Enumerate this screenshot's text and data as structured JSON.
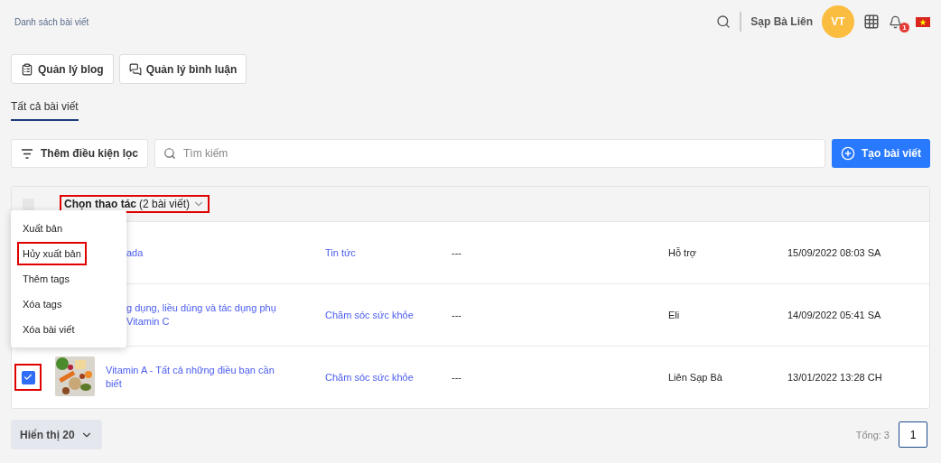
{
  "breadcrumb": "Danh sách bài viết",
  "header": {
    "user_name": "Sạp Bà Liên",
    "avatar_initials": "VT",
    "notification_count": "1"
  },
  "nav_buttons": [
    {
      "label": "Quản lý blog",
      "kind": "blog"
    },
    {
      "label": "Quản lý bình luận",
      "kind": "comments"
    }
  ],
  "tabs": [
    {
      "label": "Tất cả bài viết",
      "selected": true
    }
  ],
  "filter_button": "Thêm điều kiện lọc",
  "search": {
    "placeholder": "Tìm kiếm"
  },
  "create_button": "Tạo bài viết",
  "select_all": {
    "checked": false
  },
  "bulk_action": {
    "label": "Chọn thao tác",
    "count": "(2 bài viết)",
    "highlighted": true
  },
  "action_menu": [
    {
      "label": "Xuất bản",
      "highlighted": false
    },
    {
      "label": "Hủy xuất bản",
      "highlighted": true
    },
    {
      "label": "Thêm tags",
      "highlighted": false
    },
    {
      "label": "Xóa tags",
      "highlighted": false
    },
    {
      "label": "Xóa bài viết",
      "highlighted": false
    }
  ],
  "rows": [
    {
      "title_lines": [
        "ada"
      ],
      "category": "Tin tức",
      "tags": "---",
      "author": "Hỗ trợ",
      "date": "15/09/2022 08:03 SA"
    },
    {
      "title_lines": [
        "g dụng, liều dùng và tác dụng phụ",
        "Vitamin C"
      ],
      "category": "Chăm sóc sức khỏe",
      "tags": "---",
      "author": "Eli",
      "date": "14/09/2022 05:41 SA"
    },
    {
      "title_lines": [
        "Vitamin A - Tất cả những điều bạn cần",
        "biết"
      ],
      "checked": true,
      "highlighted": true,
      "thumbnail": {
        "kind": "picture"
      },
      "category": "Chăm sóc sức khỏe",
      "tags": "---",
      "author": "Liên Sạp Bà",
      "date": "13/01/2022 13:28 CH"
    }
  ],
  "page_size": "Hiển thị 20",
  "total": "Tổng: 3",
  "pages": [
    {
      "label": "1",
      "selected": true
    }
  ]
}
